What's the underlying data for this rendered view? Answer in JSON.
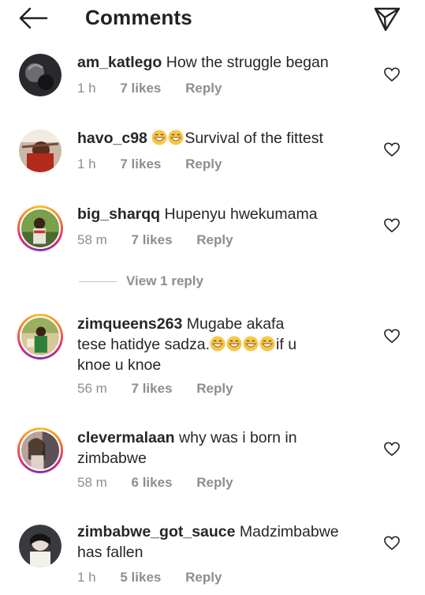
{
  "header": {
    "title": "Comments",
    "back_icon": "arrow-left-icon",
    "share_icon": "direct-send-icon"
  },
  "comments": [
    {
      "username": "am_katlego",
      "text": "How the struggle began",
      "time": "1 h",
      "likes": "7 likes",
      "reply_label": "Reply"
    },
    {
      "username": "havo_c98",
      "text_after_emoji": "Survival of the fittest",
      "emoji": [
        "grinning-sweat-emoji",
        "grinning-sweat-emoji"
      ],
      "time": "1 h",
      "likes": "7 likes",
      "reply_label": "Reply"
    },
    {
      "username": "big_sharqq",
      "text": "Hupenyu hwekumama",
      "time": "58 m",
      "likes": "7 likes",
      "reply_label": "Reply",
      "view_replies": "View 1 reply"
    },
    {
      "username": "zimqueens263",
      "text_line1": "Mugabe akafa",
      "text_line2": "tese hatidye sadza.",
      "emoji": [
        "grinning-sweat-emoji",
        "grinning-sweat-emoji",
        "grinning-sweat-emoji",
        "grinning-sweat-emoji"
      ],
      "text_after_emoji": "if u",
      "text_line3": "knoe u knoe",
      "time": "56 m",
      "likes": "7 likes",
      "reply_label": "Reply"
    },
    {
      "username": "clevermalaan",
      "text_line1": "why was i born in",
      "text_line2": "zimbabwe",
      "time": "58 m",
      "likes": "6 likes",
      "reply_label": "Reply"
    },
    {
      "username": "zimbabwe_got_sauce",
      "text_line1": "Madzimbabwe",
      "text_line2": "has fallen",
      "time": "1 h",
      "likes": "5 likes",
      "reply_label": "Reply"
    }
  ],
  "colors": {
    "text": "#262626",
    "meta": "#8e8e8e",
    "story_ring_start": "#f7c137",
    "story_ring_end": "#8134af"
  }
}
